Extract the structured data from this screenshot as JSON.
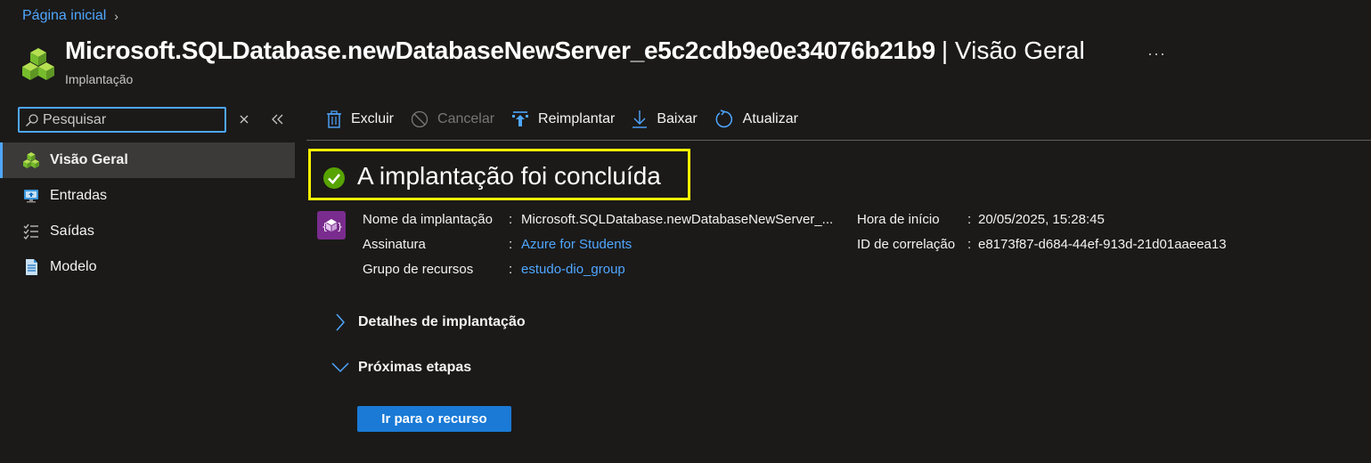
{
  "breadcrumb": {
    "home": "Página inicial",
    "separator": "›"
  },
  "header": {
    "title": "Microsoft.SQLDatabase.newDatabaseNewServer_e5c2cdb9e0e34076b21b9",
    "title_suffix": "| Visão Geral",
    "subtitle": "Implantação",
    "more": "···"
  },
  "sidebar": {
    "search_placeholder": "Pesquisar",
    "items": [
      {
        "label": "Visão Geral",
        "icon": "cubes-icon",
        "active": true
      },
      {
        "label": "Entradas",
        "icon": "monitor-input-icon",
        "active": false
      },
      {
        "label": "Saídas",
        "icon": "checklist-icon",
        "active": false
      },
      {
        "label": "Modelo",
        "icon": "document-icon",
        "active": false
      }
    ]
  },
  "toolbar": {
    "delete": "Excluir",
    "cancel": "Cancelar",
    "redeploy": "Reimplantar",
    "download": "Baixar",
    "refresh": "Atualizar"
  },
  "status": {
    "text": "A implantação foi concluída",
    "highlight_color": "#f9f100",
    "success_color": "#57a300"
  },
  "details": {
    "left": [
      {
        "label": "Nome da implantação",
        "sep": ":",
        "value": "Microsoft.SQLDatabase.newDatabaseNewServer_...",
        "link": false
      },
      {
        "label": "Assinatura",
        "sep": ":",
        "value": "Azure for Students",
        "link": true
      },
      {
        "label": "Grupo de recursos",
        "sep": ":",
        "value": "estudo-dio_group",
        "link": true
      }
    ],
    "right": [
      {
        "label": "Hora de início",
        "sep": ":",
        "value": "20/05/2025, 15:28:45"
      },
      {
        "label": "ID de correlação",
        "sep": ":",
        "value": "e8173f87-d684-44ef-913d-21d01aaeea13"
      }
    ]
  },
  "sections": {
    "deployment_details": "Detalhes de implantação",
    "next_steps": "Próximas etapas"
  },
  "actions": {
    "go_to_resource": "Ir para o recurso"
  },
  "colors": {
    "accent": "#4fa7ff",
    "background": "#1b1a19",
    "active_nav": "#3b3a39",
    "primary_button": "#1a7ad6"
  }
}
